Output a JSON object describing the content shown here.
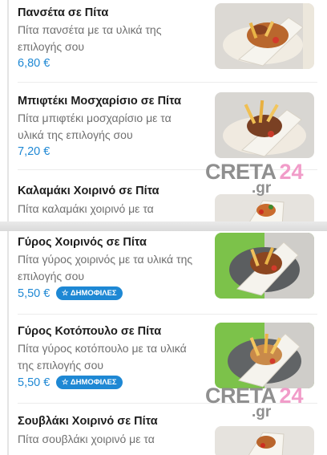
{
  "items": [
    {
      "name": "Πανσέτα σε Πίτα",
      "description": "Πίτα πανσέτα  με τα υλικά της επιλογής σου",
      "price": "6,80 €"
    },
    {
      "name": "Μπιφτέκι Μοσχαρίσιο σε Πίτα",
      "description": "Πίτα μπιφτέκι μοσχαρίσιο με τα υλικά της επιλογής σου",
      "price": "7,20 €"
    },
    {
      "name": "Καλαμάκι Χοιρινό σε Πίτα",
      "description": "Πίτα καλαμάκι χοιρινό με τα"
    },
    {
      "name": "Γύρος Χοιρινός σε Πίτα",
      "description": "Πίτα γύρος χοιρινός με τα υλικά της επιλογής σου",
      "price": "5,50 €",
      "badge": "ΔΗΜΟΦΙΛΕΣ"
    },
    {
      "name": "Γύρος Κοτόπουλο σε Πίτα",
      "description": "Πίτα γύρος κοτόπουλο με τα υλικά της επιλογής σου",
      "price": "5,50 €",
      "badge": "ΔΗΜΟΦΙΛΕΣ"
    },
    {
      "name": "Σουβλάκι Χοιρινό σε Πίτα",
      "description": "Πίτα σουβλάκι χοιρινό με τα"
    }
  ],
  "badge_icon": "star-icon",
  "watermark": {
    "text1": "CRETA",
    "text2": "24",
    "text3": ".gr"
  },
  "colors": {
    "price": "#1e88d4",
    "badge_bg": "#1e88d4",
    "name": "#1d1d1d",
    "description": "#6f6f6f",
    "watermark_gray": "#8f8f8f",
    "watermark_pink": "#f19cc9",
    "photo_green_bg": "#7cc24a"
  }
}
